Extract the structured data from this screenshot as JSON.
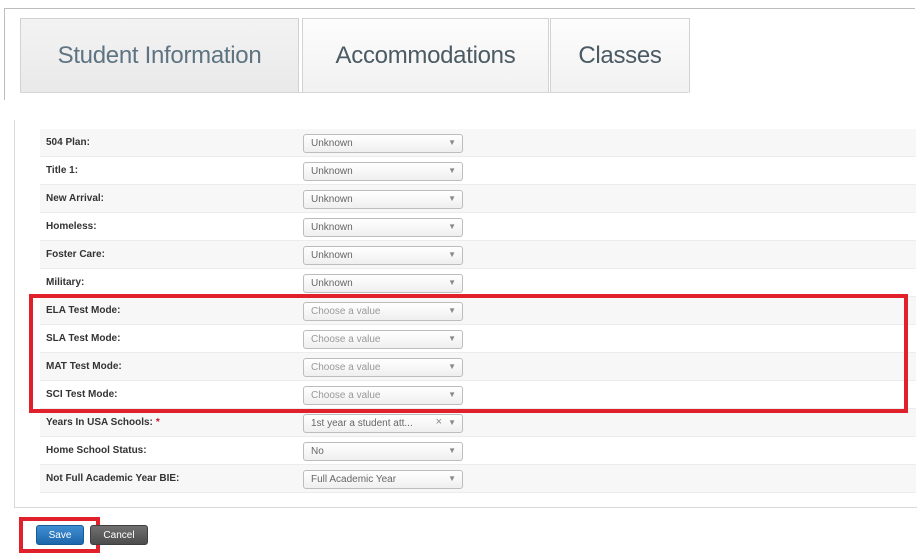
{
  "tabs": [
    {
      "label": "Student Information",
      "active": true
    },
    {
      "label": "Accommodations",
      "active": false
    },
    {
      "label": "Classes",
      "active": false
    }
  ],
  "form": {
    "rows": [
      {
        "label": "504 Plan:",
        "value": "Unknown",
        "placeholder": false,
        "required": false
      },
      {
        "label": "Title 1:",
        "value": "Unknown",
        "placeholder": false,
        "required": false
      },
      {
        "label": "New Arrival:",
        "value": "Unknown",
        "placeholder": false,
        "required": false
      },
      {
        "label": "Homeless:",
        "value": "Unknown",
        "placeholder": false,
        "required": false
      },
      {
        "label": "Foster Care:",
        "value": "Unknown",
        "placeholder": false,
        "required": false
      },
      {
        "label": "Military:",
        "value": "Unknown",
        "placeholder": false,
        "required": false
      },
      {
        "label": "ELA Test Mode:",
        "value": "Choose a value",
        "placeholder": true,
        "required": false
      },
      {
        "label": "SLA Test Mode:",
        "value": "Choose a value",
        "placeholder": true,
        "required": false
      },
      {
        "label": "MAT Test Mode:",
        "value": "Choose a value",
        "placeholder": true,
        "required": false
      },
      {
        "label": "SCI Test Mode:",
        "value": "Choose a value",
        "placeholder": true,
        "required": false
      },
      {
        "label": "Years In USA Schools:",
        "value": "1st year a student att...",
        "placeholder": false,
        "required": true,
        "clearable": true
      },
      {
        "label": "Home School Status:",
        "value": "No",
        "placeholder": false,
        "required": false
      },
      {
        "label": "Not Full Academic Year BIE:",
        "value": "Full Academic Year",
        "placeholder": false,
        "required": false
      }
    ],
    "required_marker": "*",
    "clear_glyph": "×",
    "arrow_glyph": "▼"
  },
  "actions": {
    "save_label": "Save",
    "cancel_label": "Cancel"
  },
  "colors": {
    "highlight": "#e0202a",
    "save_button": "#1d66ad",
    "cancel_button": "#4c4c4c",
    "required": "#c8102e"
  },
  "icons": {
    "dropdown": "chevron-down-icon",
    "clear": "clear-selection-icon"
  }
}
